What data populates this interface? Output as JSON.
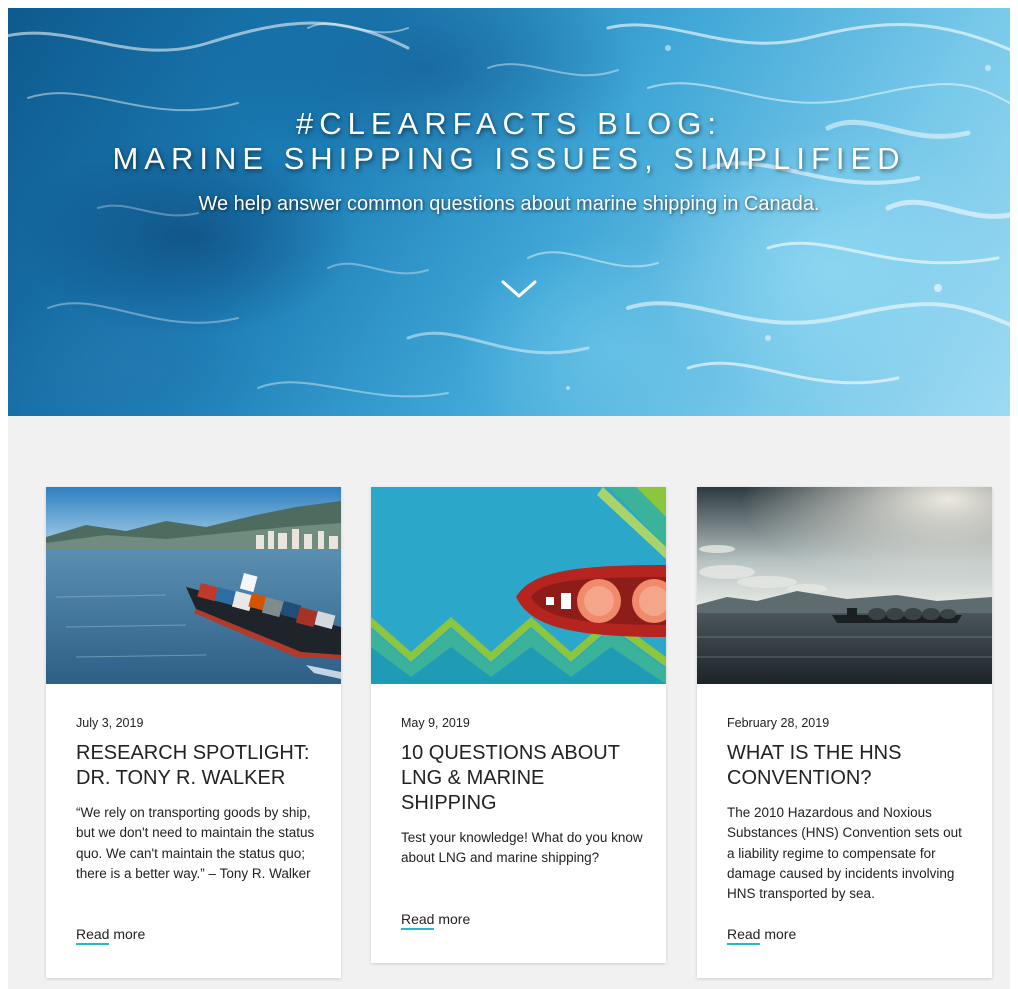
{
  "hero": {
    "title_line_1": "#CLEARFACTS BLOG:",
    "title_line_2": "MARINE SHIPPING ISSUES, SIMPLIFIED",
    "subtitle": "We help answer common questions about marine shipping in Canada.",
    "scroll_icon": "chevron-down-icon"
  },
  "cards": [
    {
      "date": "July 3, 2019",
      "title": "RESEARCH SPOTLIGHT: DR. TONY R. WALKER",
      "excerpt": "“We rely on transporting goods by ship, but we don't need to maintain the status quo. We can't maintain the status quo; there is a better way.” – Tony R. Walker",
      "read_more_1": "Read",
      "read_more_2": "more",
      "image": "container-ship-harbour-photo"
    },
    {
      "date": "May 9, 2019",
      "title": "10 QUESTIONS ABOUT LNG & MARINE SHIPPING",
      "excerpt": "Test your knowledge! What do you know about LNG and marine shipping?",
      "read_more_1": "Read",
      "read_more_2": "more",
      "image": "lng-tanker-illustration"
    },
    {
      "date": "February 28, 2019",
      "title": "WHAT IS THE HNS CONVENTION?",
      "excerpt": "The 2010 Hazardous and Noxious Substances (HNS) Convention sets out a liability regime to compensate for damage caused by incidents involving HNS transported by sea.",
      "read_more_1": "Read",
      "read_more_2": "more",
      "image": "tanker-at-sea-photo"
    }
  ],
  "colors": {
    "background": "#f1f1f1",
    "card": "#ffffff",
    "accent_underline": "#2bb5c8",
    "text": "#222222"
  }
}
